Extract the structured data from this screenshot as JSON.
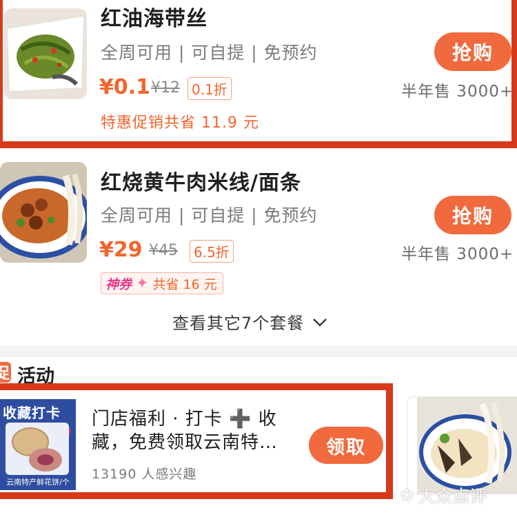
{
  "deals": [
    {
      "title": "红油海带丝",
      "meta": "全周可用 | 可自提 | 免预约",
      "price": "¥0.1",
      "original_price": "¥12",
      "discount": "0.1折",
      "sold": "半年售 3000+",
      "buy_label": "抢购",
      "promo": "特惠促销共省 11.9 元"
    },
    {
      "title": "红烧黄牛肉米线/面条",
      "meta": "全周可用 | 可自提 | 免预约",
      "price": "¥29",
      "original_price": "¥45",
      "discount": "6.5折",
      "sold": "半年售 3000+",
      "buy_label": "抢购",
      "coupon_brand": "神券",
      "coupon_text": "共省 16 元"
    }
  ],
  "more_packages": "查看其它7个套餐",
  "section": {
    "badge": "促",
    "title": "活动"
  },
  "activity": {
    "title": "门店福利 · 打卡 ➕ 收藏，免费领取云南特…",
    "interest": "13190 人感兴趣",
    "claim_label": "领取",
    "poster_text": "收藏打卡",
    "poster_badge": "送",
    "poster_caption": "云南特产鲜花饼/个"
  },
  "watermark": "大众点评",
  "colors": {
    "accent": "#f06a3e",
    "price": "#f2652c",
    "highlight": "#d8391b",
    "coupon_brand": "#e9398a"
  }
}
